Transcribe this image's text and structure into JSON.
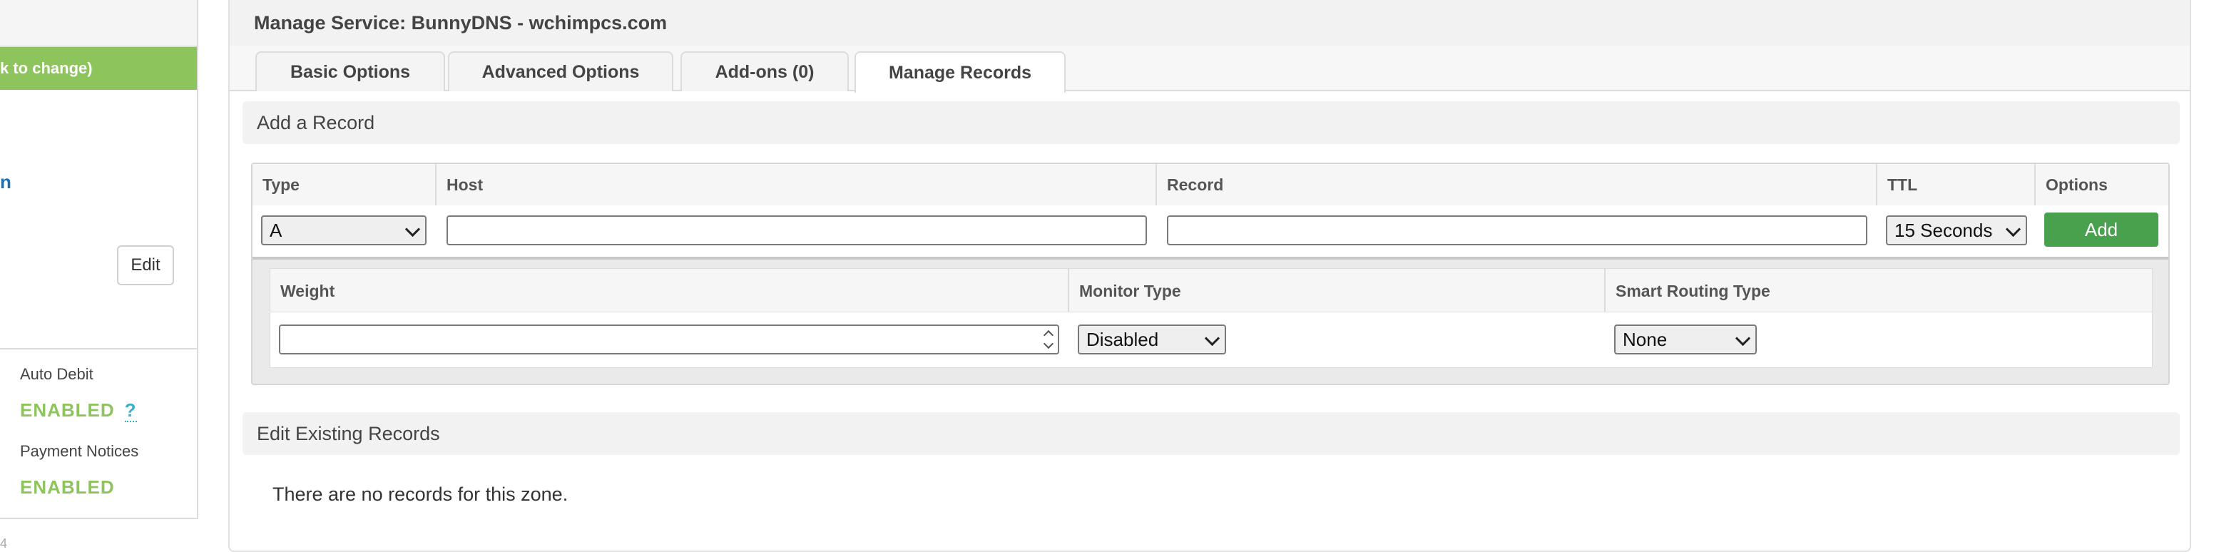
{
  "sidebar": {
    "green_banner": "k to change)",
    "link_fragment": "n",
    "edit_label": "Edit",
    "auto_debit_label": "Auto Debit",
    "auto_debit_value": "ENABLED",
    "help_mark": "?",
    "payment_notices_label": "Payment Notices",
    "payment_notices_value": "ENABLED",
    "footer_fragment": "4"
  },
  "panel": {
    "title": "Manage Service: BunnyDNS - wchimpcs.com",
    "tabs": [
      {
        "label": "Basic Options",
        "active": false
      },
      {
        "label": "Advanced Options",
        "active": false
      },
      {
        "label": "Add-ons (0)",
        "active": false
      },
      {
        "label": "Manage Records",
        "active": true
      }
    ]
  },
  "add_record": {
    "heading": "Add a Record",
    "columns": [
      "Type",
      "Host",
      "Record",
      "TTL",
      "Options"
    ],
    "type_value": "A",
    "host_value": "",
    "record_value": "",
    "ttl_value": "15 Seconds",
    "add_label": "Add",
    "sub_columns": [
      "Weight",
      "Monitor Type",
      "Smart Routing Type"
    ],
    "weight_value": "",
    "monitor_value": "Disabled",
    "routing_value": "None"
  },
  "existing": {
    "heading": "Edit Existing Records",
    "empty_message": "There are no records for this zone."
  },
  "colors": {
    "accent_green": "#8dc45c",
    "button_green": "#4aa14d",
    "link_blue": "#1b6fb0"
  }
}
